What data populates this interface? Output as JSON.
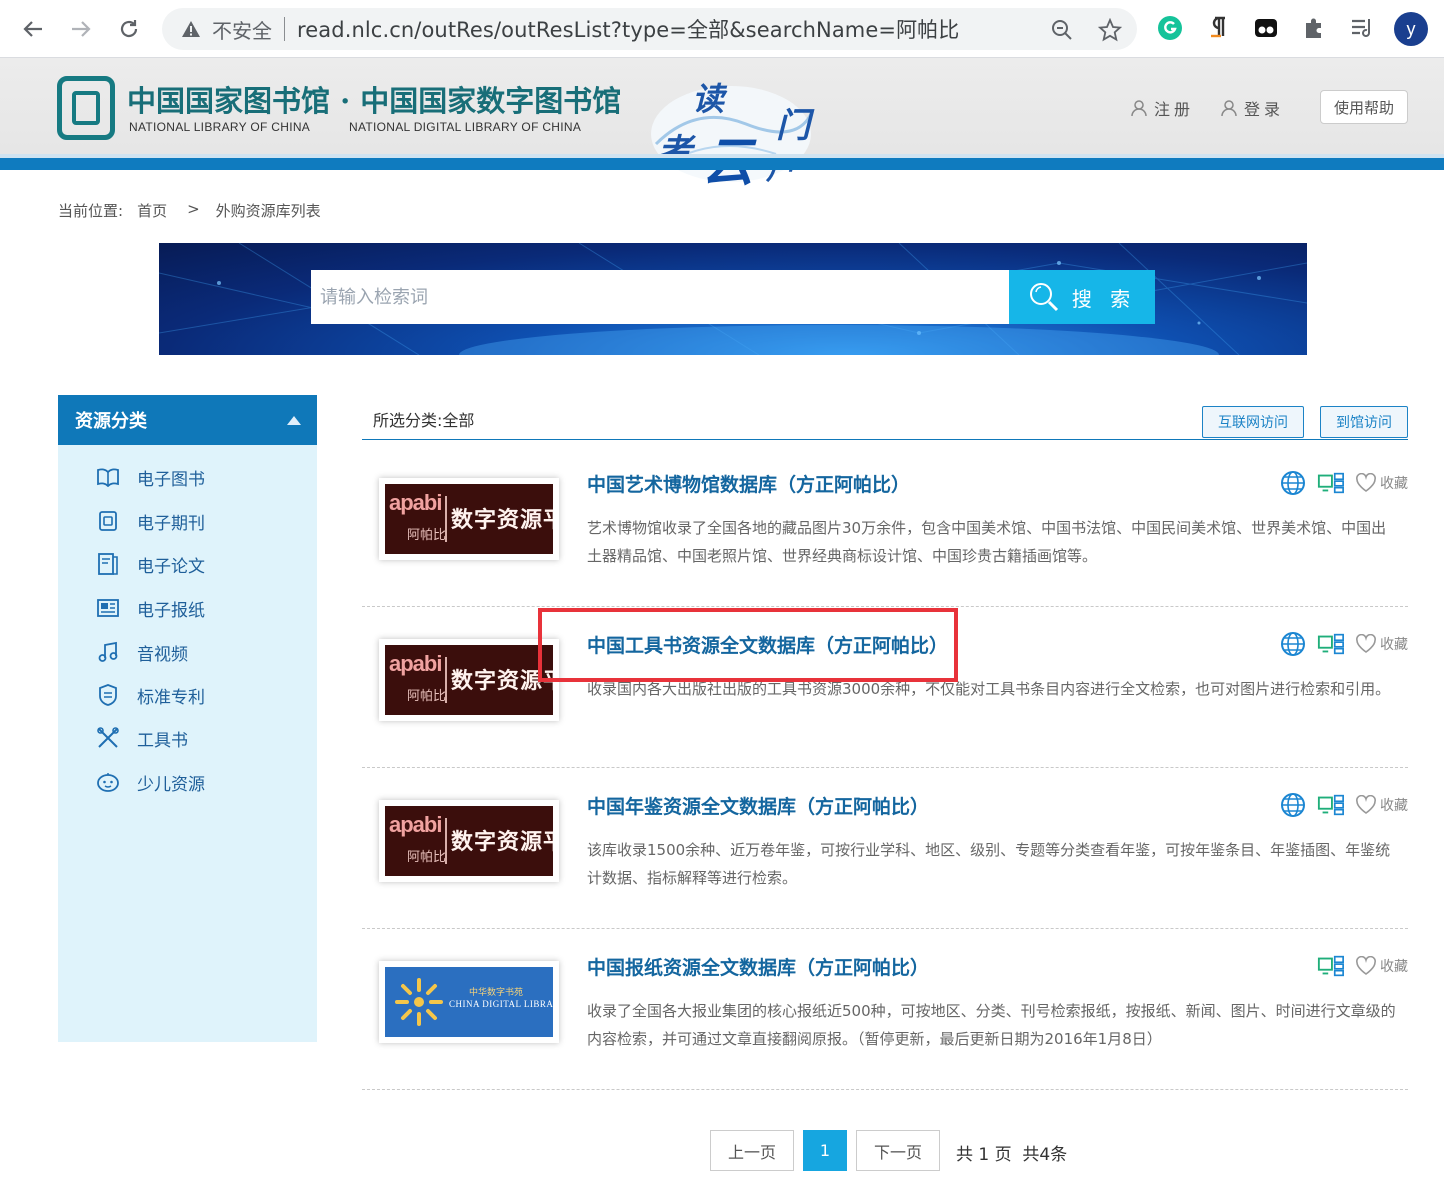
{
  "browser": {
    "insecure_label": "不安全",
    "url": "read.nlc.cn/outRes/outResList?type=全部&searchName=阿帕比",
    "avatar_letter": "y"
  },
  "header": {
    "logo_cn": "中国国家图书馆 · 中国国家数字图书馆",
    "logo_en_1": "NATIONAL LIBRARY OF CHINA",
    "logo_en_2": "NATIONAL DIGITAL LIBRARY OF CHINA",
    "cloud_chars": [
      "读",
      "者",
      "云",
      "门",
      "户"
    ],
    "register_label": "注册",
    "login_label": "登录",
    "help_label": "使用帮助"
  },
  "breadcrumb": {
    "prefix": "当前位置:",
    "home": "首页",
    "separator": ">",
    "current": "外购资源库列表"
  },
  "search": {
    "placeholder": "请输入检索词",
    "button_label": "搜 索"
  },
  "sidebar": {
    "title": "资源分类",
    "items": [
      {
        "label": "电子图书",
        "icon": "open-book-icon"
      },
      {
        "label": "电子期刊",
        "icon": "journal-icon"
      },
      {
        "label": "电子论文",
        "icon": "thesis-icon"
      },
      {
        "label": "电子报纸",
        "icon": "newspaper-icon"
      },
      {
        "label": "音视频",
        "icon": "music-note-icon"
      },
      {
        "label": "标准专利",
        "icon": "standard-patent-icon"
      },
      {
        "label": "工具书",
        "icon": "tools-icon"
      },
      {
        "label": "少儿资源",
        "icon": "children-icon"
      }
    ]
  },
  "list": {
    "selected_prefix": "所选分类:",
    "selected_value": "全部",
    "filter_internet": "互联网访问",
    "filter_onsite": "到馆访问",
    "favorite_label": "收藏",
    "items": [
      {
        "title": "中国艺术博物馆数据库（方正阿帕比）",
        "desc": "艺术博物馆收录了全国各地的藏品图片30万余件，包含中国美术馆、中国书法馆、中国民间美术馆、世界美术馆、中国出土器精品馆、中国老照片馆、世界经典商标设计馆、中国珍贵古籍插画馆等。",
        "thumb": {
          "type": "apabi",
          "en": "apabi",
          "cn_small": "阿帕比",
          "cn_big": "数字资源平台"
        }
      },
      {
        "title": "中国工具书资源全文数据库（方正阿帕比）",
        "desc": "收录国内各大出版社出版的工具书资源3000余种，不仅能对工具书条目内容进行全文检索，也可对图片进行检索和引用。",
        "thumb": {
          "type": "apabi",
          "en": "apabi",
          "cn_small": "阿帕比",
          "cn_big": "数字资源平台"
        }
      },
      {
        "title": "中国年鉴资源全文数据库（方正阿帕比）",
        "desc": "该库收录1500余种、近万卷年鉴，可按行业学科、地区、级别、专题等分类查看年鉴，可按年鉴条目、年鉴插图、年鉴统计数据、指标解释等进行检索。",
        "thumb": {
          "type": "apabi",
          "en": "apabi",
          "cn_small": "阿帕比",
          "cn_big": "数字资源平台"
        }
      },
      {
        "title": "中国报纸资源全文数据库（方正阿帕比）",
        "desc": "收录了全国各大报业集团的核心报纸近500种，可按地区、分类、刊号检索报纸，按报纸、新闻、图片、时间进行文章级的内容检索，并可通过文章直接翻阅原报。（暂停更新，最后更新日期为2016年1月8日）",
        "thumb": {
          "type": "cdl",
          "cn": "中华数字书苑",
          "en": "CHINA DIGITAL LIBRARY"
        }
      }
    ]
  },
  "pagination": {
    "prev": "上一页",
    "current": "1",
    "next": "下一页",
    "summary": "共 1 页  共4条"
  },
  "colors": {
    "brand_blue": "#0f78b9",
    "title_blue": "#14669f",
    "search_button": "#16b6e8",
    "highlight": "#e8323a"
  }
}
